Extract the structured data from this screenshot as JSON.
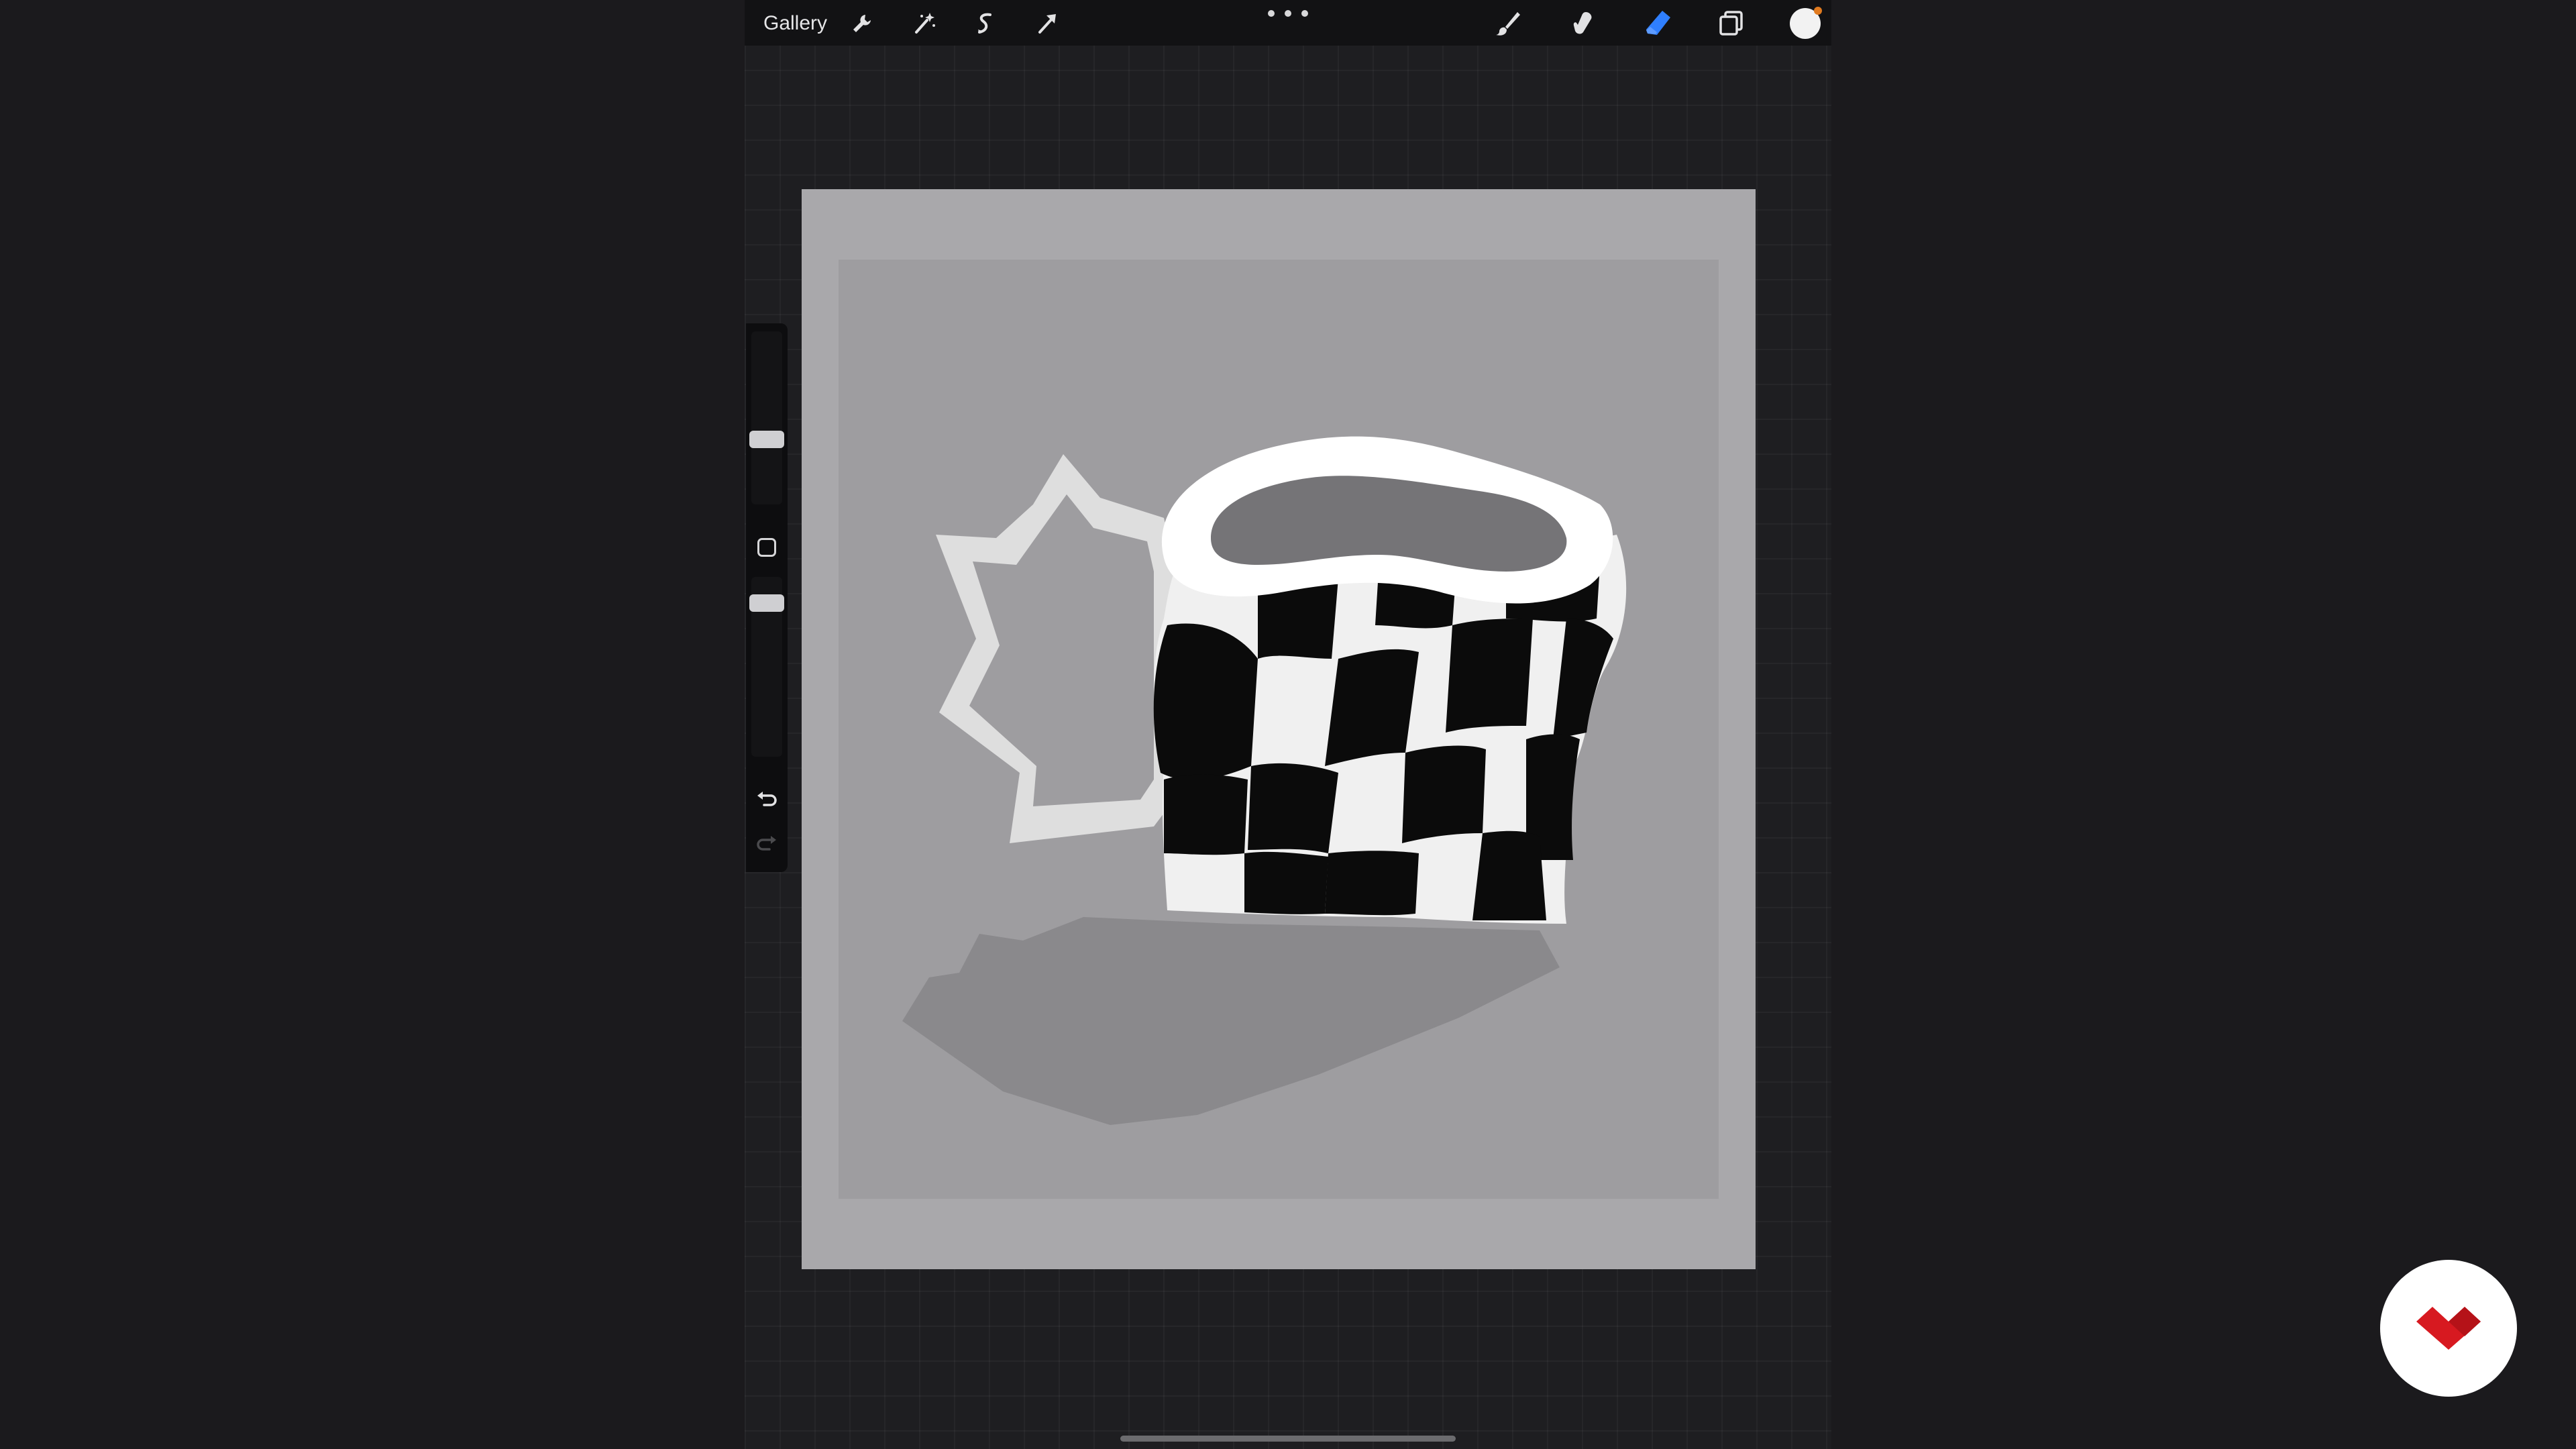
{
  "topbar": {
    "gallery_label": "Gallery",
    "left_tools": [
      "wrench-icon",
      "magic-wand-icon",
      "selection-icon",
      "transform-arrow-icon"
    ],
    "right_tools": [
      "brush-icon",
      "smudge-icon",
      "eraser-icon",
      "layers-icon"
    ],
    "active_tool": "eraser-icon",
    "current_color": "#f2f2f2"
  },
  "sidebar": {
    "brush_size_level": 0.5,
    "opacity_level": 0.2,
    "undo_icon": "undo-icon",
    "redo_icon": "redo-icon"
  },
  "colors": {
    "accent_active_tool": "#2f7fff",
    "canvas_paper": "#a9a8ab",
    "brand_red": "#d71920"
  },
  "branding": {
    "icon": "domestika-logo-icon"
  }
}
